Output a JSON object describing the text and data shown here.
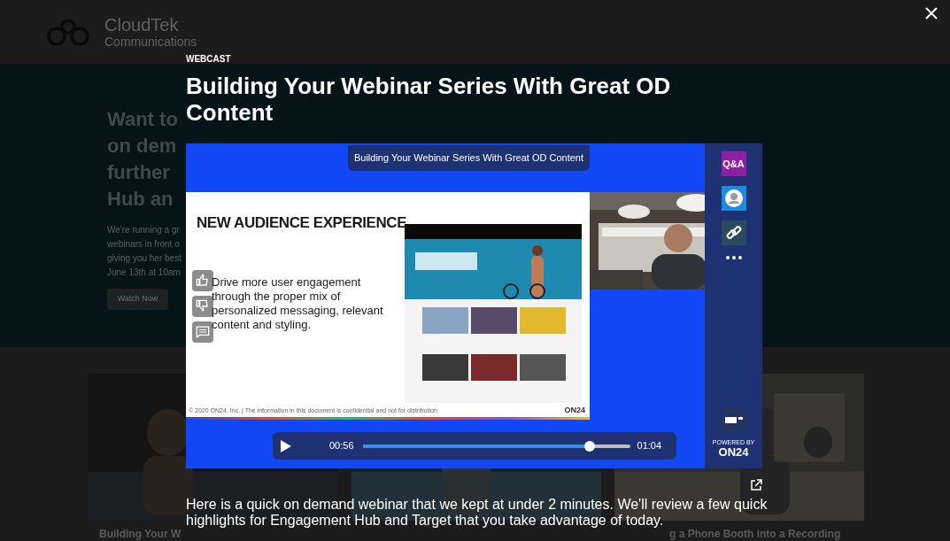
{
  "background_page": {
    "logo": {
      "name": "CloudTek",
      "tagline": "Communications"
    },
    "hero": {
      "heading_lines": [
        "Want to",
        "on dem",
        "further",
        "Hub an"
      ],
      "body_lines": [
        "We're running a gr",
        "webinars in front o",
        "giving you her best",
        "June 13th at 10am"
      ],
      "button": "Watch Now"
    },
    "cards": [
      {
        "title": "Building Your W"
      },
      {
        "kind": "picture"
      },
      {
        "title": "g a Phone Booth into a Recording"
      }
    ]
  },
  "modal": {
    "label": "WEBCAST",
    "title": "Building Your Webinar Series With Great OD Content",
    "player": {
      "banner": "Building Your Webinar Series With Great OD Content",
      "slide": {
        "heading": "NEW AUDIENCE EXPERIENCE",
        "body": "Drive more user engagement through the proper mix of personalized messaging, relevant content and styling.",
        "footer": "© 2020 ON24, Inc.  |  The information in this document is confidential and not for distribution",
        "brand": "ON24"
      },
      "sidebar": {
        "qa_label": "Q&A",
        "powered_by": "POWERED BY",
        "brand": "ON24"
      },
      "controls": {
        "elapsed": "00:56",
        "duration": "01:04",
        "level": 0.85
      }
    },
    "description": "Here is a quick on demand webinar that we kept at under 2 minutes. We'll review a few quick highlights for Engagement Hub and Target that you take advantage of today."
  }
}
